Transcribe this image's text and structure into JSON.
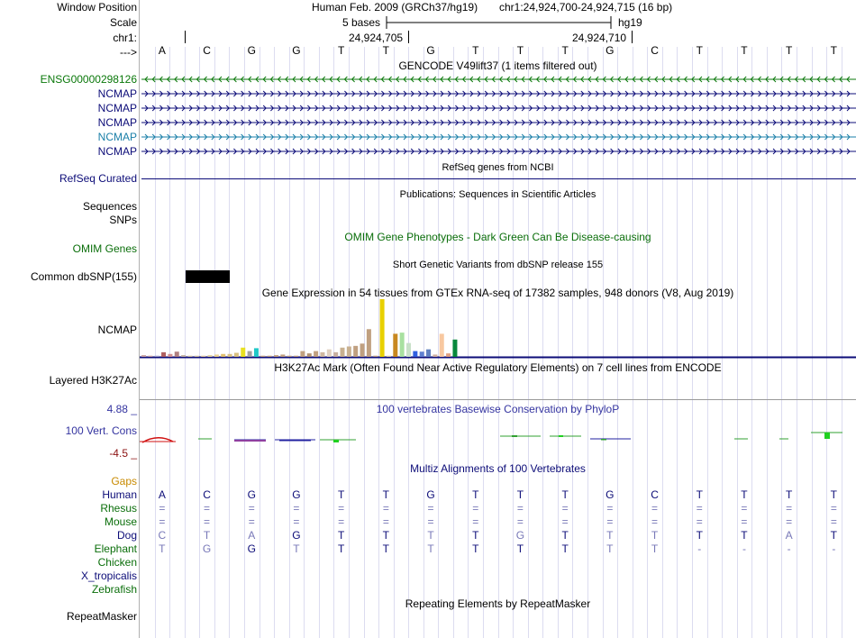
{
  "header": {
    "window_position_label": "Window Position",
    "assembly": "Human Feb. 2009 (GRCh37/hg19)",
    "position": "chr1:24,924,700-24,924,715 (16 bp)",
    "scale_label": "Scale",
    "scale_text": "5 bases",
    "scale_db": "hg19",
    "chrom_label": "chr1:",
    "pos_tick_1": "24,924,705",
    "pos_tick_2": "24,924,710",
    "arrow_label": "--->"
  },
  "sequence": [
    "A",
    "C",
    "G",
    "G",
    "T",
    "T",
    "G",
    "T",
    "T",
    "T",
    "G",
    "C",
    "T",
    "T",
    "T",
    "T"
  ],
  "gencode": {
    "title": "GENCODE V49lift37 (1 items filtered out)",
    "genes": [
      {
        "name": "ENSG00000298126",
        "color": "#0a780a",
        "strand": "-"
      },
      {
        "name": "NCMAP",
        "color": "#0c0c78",
        "strand": "+"
      },
      {
        "name": "NCMAP",
        "color": "#0c0c78",
        "strand": "+"
      },
      {
        "name": "NCMAP",
        "color": "#0c0c78",
        "strand": "+"
      },
      {
        "name": "NCMAP",
        "color": "#1a7fa8",
        "strand": "+"
      },
      {
        "name": "NCMAP",
        "color": "#0c0c78",
        "strand": "+"
      }
    ]
  },
  "refseq": {
    "title": "RefSeq genes from NCBI",
    "label": "RefSeq Curated",
    "color": "#0c0c78"
  },
  "publications": {
    "title": "Publications: Sequences in Scientific Articles",
    "label1": "Sequences",
    "label2": "SNPs"
  },
  "omim": {
    "title": "OMIM Gene Phenotypes - Dark Green Can Be Disease-causing",
    "label": "OMIM Genes",
    "color": "#0a6e0a"
  },
  "dbsnp": {
    "title": "Short Genetic Variants from dbSNP release 155",
    "label": "Common dbSNP(155)"
  },
  "gtex": {
    "title": "Gene Expression in 54 tissues from GTEx RNA-seq of 17382 samples, 948 donors (V8, Aug 2019)",
    "label": "NCMAP",
    "bars": [
      {
        "v": 0.03,
        "c": "#c8a0a0"
      },
      {
        "v": 0.02,
        "c": "#c8a0a0"
      },
      {
        "v": 0.02,
        "c": "#a0a0c8"
      },
      {
        "v": 0.08,
        "c": "#b06060"
      },
      {
        "v": 0.05,
        "c": "#d09090"
      },
      {
        "v": 0.09,
        "c": "#b08080"
      },
      {
        "v": 0.03,
        "c": "#c0b0a0"
      },
      {
        "v": 0.02,
        "c": "#d0c0a0"
      },
      {
        "v": 0.02,
        "c": "#d0c0a0"
      },
      {
        "v": 0.02,
        "c": "#e0c8a0"
      },
      {
        "v": 0.03,
        "c": "#e0d0a0"
      },
      {
        "v": 0.04,
        "c": "#e8d090"
      },
      {
        "v": 0.05,
        "c": "#e0c070"
      },
      {
        "v": 0.05,
        "c": "#d8c080"
      },
      {
        "v": 0.07,
        "c": "#d8c080"
      },
      {
        "v": 0.16,
        "c": "#e8e020"
      },
      {
        "v": 0.1,
        "c": "#a0a0a0"
      },
      {
        "v": 0.15,
        "c": "#20c8c8"
      },
      {
        "v": 0.02,
        "c": "#c0a080"
      },
      {
        "v": 0.02,
        "c": "#c0a080"
      },
      {
        "v": 0.03,
        "c": "#c0a080"
      },
      {
        "v": 0.04,
        "c": "#c0a080"
      },
      {
        "v": 0.02,
        "c": "#c0a080"
      },
      {
        "v": 0.02,
        "c": "#c0a080"
      },
      {
        "v": 0.1,
        "c": "#c0a080"
      },
      {
        "v": 0.06,
        "c": "#b09070"
      },
      {
        "v": 0.1,
        "c": "#c0a080"
      },
      {
        "v": 0.08,
        "c": "#d0b8a0"
      },
      {
        "v": 0.13,
        "c": "#e0d0c0"
      },
      {
        "v": 0.08,
        "c": "#c8b0a0"
      },
      {
        "v": 0.16,
        "c": "#c8b090"
      },
      {
        "v": 0.18,
        "c": "#c8b090"
      },
      {
        "v": 0.19,
        "c": "#c0a080"
      },
      {
        "v": 0.23,
        "c": "#c0a080"
      },
      {
        "v": 0.48,
        "c": "#c0a080"
      },
      {
        "v": 0.02,
        "c": "#c0a080"
      },
      {
        "v": 1.0,
        "c": "#e8d000"
      },
      {
        "v": 0.02,
        "c": "#e0d0a0"
      },
      {
        "v": 0.4,
        "c": "#c88820"
      },
      {
        "v": 0.42,
        "c": "#a8e0a0"
      },
      {
        "v": 0.24,
        "c": "#c8e0c8"
      },
      {
        "v": 0.1,
        "c": "#3060e0"
      },
      {
        "v": 0.09,
        "c": "#6080d0"
      },
      {
        "v": 0.13,
        "c": "#6080c0"
      },
      {
        "v": 0.04,
        "c": "#d0b0a0"
      },
      {
        "v": 0.4,
        "c": "#f8c8a0"
      },
      {
        "v": 0.06,
        "c": "#e0a080"
      },
      {
        "v": 0.3,
        "c": "#08883c"
      }
    ]
  },
  "h3k27ac": {
    "title": "H3K27Ac Mark (Often Found Near Active Regulatory Elements) on 7 cell lines from ENCODE",
    "label": "Layered H3K27Ac"
  },
  "phylop": {
    "title": "100 vertebrates Basewise Conservation by PhyloP",
    "label": "100 Vert. Cons",
    "max": "4.88 _",
    "min": "-4.5 _",
    "title_color": "#3434a0",
    "max_color": "#3434a0",
    "min_color": "#8b1010"
  },
  "multiz": {
    "title": "Multiz Alignments of 100 Vertebrates",
    "title_color": "#0c0c78",
    "gaps_label": "Gaps",
    "gaps_color": "#c88a00",
    "species": [
      {
        "name": "Human",
        "bases": [
          "A",
          "C",
          "G",
          "G",
          "T",
          "T",
          "G",
          "T",
          "T",
          "T",
          "G",
          "C",
          "T",
          "T",
          "T",
          "T"
        ]
      },
      {
        "name": "Rhesus",
        "bases": [
          "=",
          "=",
          "=",
          "=",
          "=",
          "=",
          "=",
          "=",
          "=",
          "=",
          "=",
          "=",
          "=",
          "=",
          "=",
          "="
        ]
      },
      {
        "name": "Mouse",
        "bases": [
          "=",
          "=",
          "=",
          "=",
          "=",
          "=",
          "=",
          "=",
          "=",
          "=",
          "=",
          "=",
          "=",
          "=",
          "=",
          "="
        ]
      },
      {
        "name": "Dog",
        "bases": [
          "C",
          "T",
          "A",
          "G",
          "T",
          "T",
          "T",
          "T",
          "G",
          "T",
          "T",
          "T",
          "T",
          "T",
          "A",
          "T"
        ]
      },
      {
        "name": "Elephant",
        "bases": [
          "T",
          "G",
          "G",
          "T",
          "T",
          "T",
          "T",
          "T",
          "T",
          "T",
          "T",
          "T",
          "-",
          "-",
          "-",
          "-"
        ]
      },
      {
        "name": "Chicken",
        "bases": []
      },
      {
        "name": "X_tropicalis",
        "bases": []
      },
      {
        "name": "Zebrafish",
        "bases": []
      }
    ]
  },
  "repeatmasker": {
    "title": "Repeating Elements by RepeatMasker",
    "label": "RepeatMasker"
  }
}
